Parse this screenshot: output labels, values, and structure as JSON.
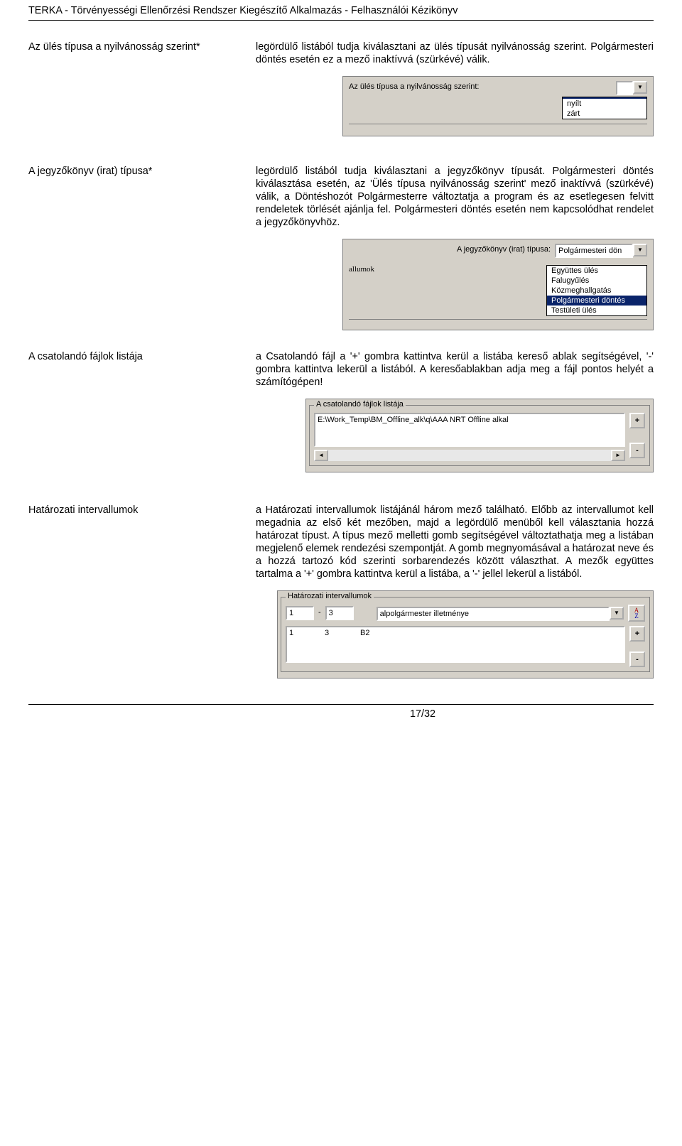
{
  "header": "TERKA - Törvényességi Ellenőrzési Rendszer Kiegészítő Alkalmazás - Felhasználói Kézikönyv",
  "sec1": {
    "term": "Az ülés típusa a nyilvánosság  szerint*",
    "desc": "legördülő listából tudja kiválasztani az ülés típusát nyilvánosság szerint. Polgármesteri döntés esetén ez a mező inaktívvá (szürkévé) válik.",
    "ui_label": "Az ülés típusa a nyilvánosság szerint:",
    "options": {
      "blank": "",
      "o1": "nyílt",
      "o2": "zárt"
    }
  },
  "sec2": {
    "term": "A jegyzőkönyv (irat) típusa*",
    "desc": "legördülő listából tudja kiválasztani a jegyzőkönyv típusát. Polgármesteri döntés kiválasztása esetén, az 'Ülés típusa nyilvánosság szerint' mező inaktívvá (szürkévé) válik, a Döntéshozót Polgármesterre változtatja a program és az esetlegesen felvitt rendeletek törlését ajánlja fel. Polgármesteri döntés esetén nem kapcsolódhat rendelet a jegyzőkönyvhöz.",
    "ui_label": "A jegyzőkönyv (irat) típusa:",
    "ui_value": "Polgármesteri dön",
    "fragment": "allumok",
    "options": {
      "o1": "Együttes ülés",
      "o2": "Falugyűlés",
      "o3": "Közmeghallgatás",
      "o4": "Polgármesteri döntés",
      "o5": "Testületi ülés"
    }
  },
  "sec3": {
    "term": "A csatolandó fájlok listája",
    "desc": "a Csatolandó fájl a '+' gombra kattintva kerül a listába kereső ablak segítségével, '-' gombra kattintva lekerül a listából. A keresőablakban adja meg a fájl pontos helyét a számítógépen!",
    "group_label": "A csatolandó fájlok listája",
    "list_item": "E:\\Work_Temp\\BM_Offline_alk\\q\\AAA NRT Offline alkal",
    "plus": "+",
    "minus": "-"
  },
  "sec4": {
    "term": "Határozati intervallumok",
    "desc": "a Határozati intervallumok listájánál három mező található. Előbb az intervallumot kell megadnia az első két mezőben, majd a legördülő menüből kell választania hozzá határozat típust. A típus mező melletti gomb segítségével változtathatja meg a listában megjelenő elemek rendezési szempontját. A gomb megnyomásával a határozat neve és a hozzá tartozó kód szerinti sorbarendezés között választhat. A mezők együttes tartalma a '+' gombra kattintva kerül a listába, a '-' jellel lekerül a listából.",
    "group_label": "Határozati intervallumok",
    "from": "1",
    "dash": "-",
    "to": "3",
    "combo_value": "alpolgármester illetménye",
    "row": {
      "c1": "1",
      "c2": "3",
      "c3": "B2"
    },
    "sort_label": "A\nZ",
    "plus": "+",
    "minus": "-"
  },
  "footer": "17/32"
}
